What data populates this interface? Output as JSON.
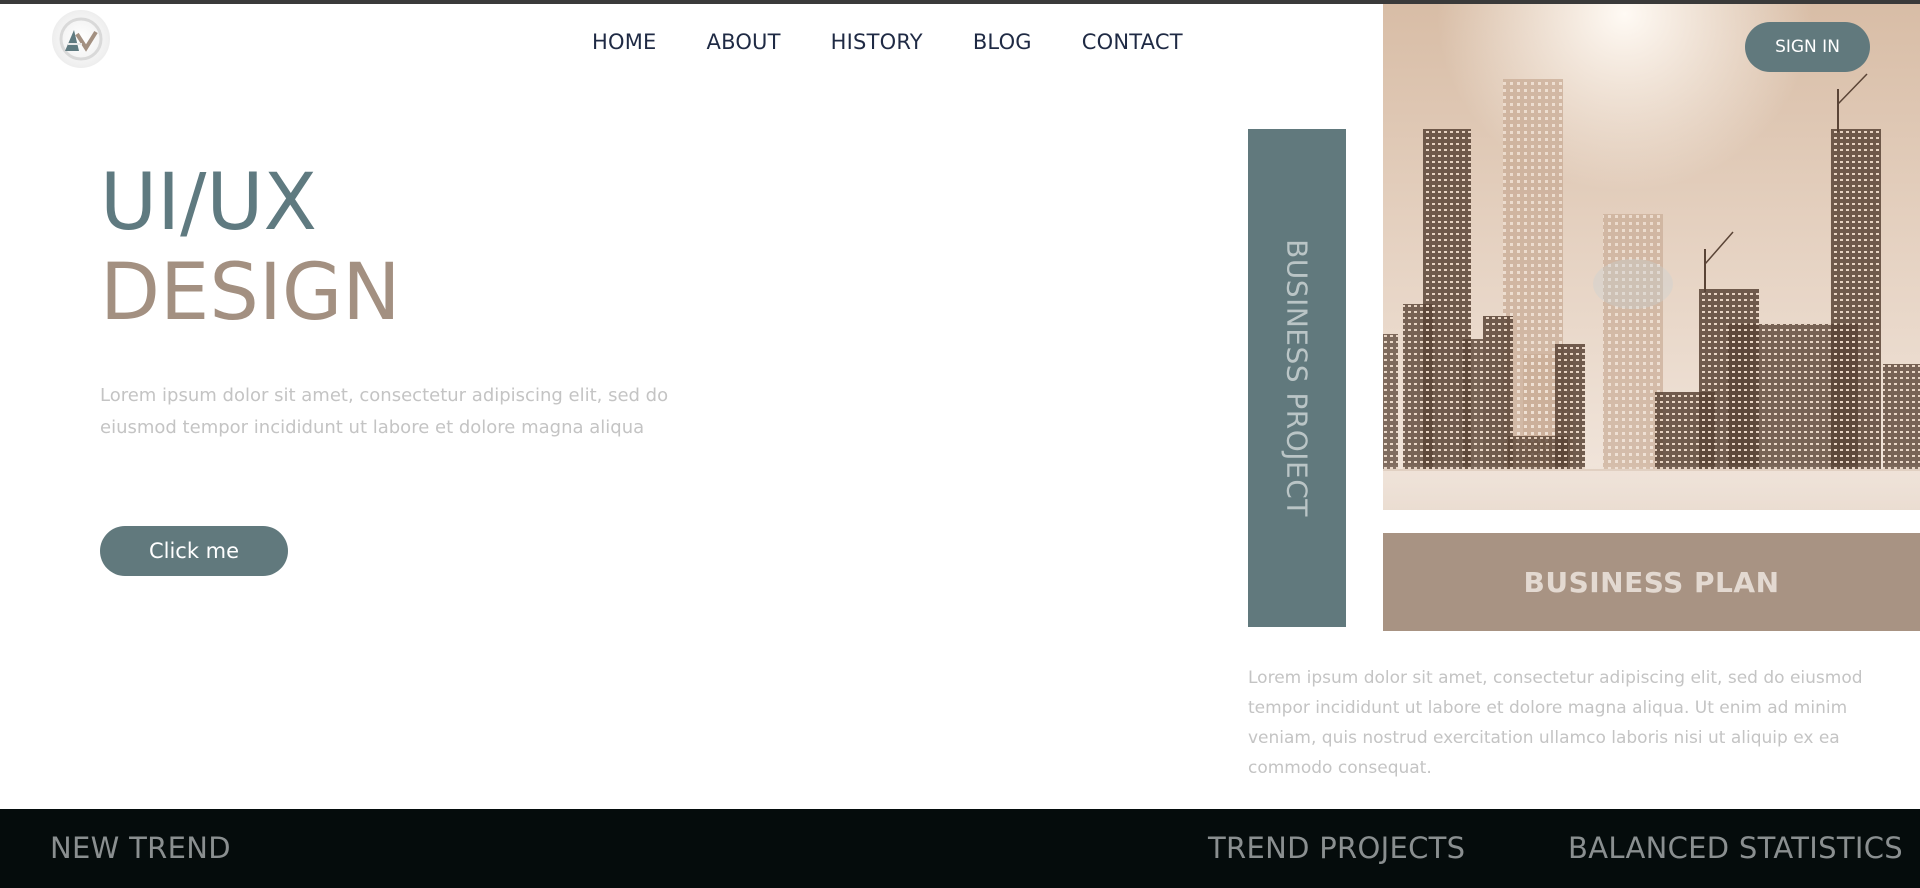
{
  "brand": {
    "logo_icon": "av-monogram-icon",
    "logo_letters": "AV"
  },
  "nav": {
    "items": [
      "HOME",
      "ABOUT",
      "HISTORY",
      "BLOG",
      "CONTACT"
    ]
  },
  "header": {
    "signin_label": "SIGN IN"
  },
  "hero": {
    "title_line1": "UI/UX",
    "title_line2": "DESIGN",
    "description": "Lorem ipsum dolor sit amet, consectetur adipiscing elit, sed do eiusmod tempor incididunt ut labore et dolore magna aliqua",
    "cta_label": "Click me"
  },
  "side": {
    "vertical_label": "BUSINESS PROJECT",
    "plan_label": "BUSINESS PLAN",
    "image": "city-skyline-illustration",
    "description": "Lorem ipsum dolor sit amet, consectetur adipiscing elit, sed do eiusmod tempor incididunt ut labore et dolore magna aliqua. Ut enim ad minim veniam, quis nostrud exercitation ullamco laboris nisi ut aliquip ex ea commodo consequat."
  },
  "footer": {
    "left": "NEW TREND",
    "middle": "TREND PROJECTS",
    "right": "BALANCED STATISTICS"
  },
  "colors": {
    "accent_slate": "#61797d",
    "accent_tan": "#a89383",
    "nav_text": "#1f2a44",
    "footer_bg": "#050c0c"
  }
}
